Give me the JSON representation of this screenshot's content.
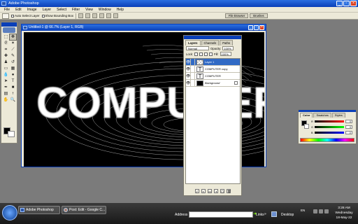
{
  "app": {
    "title": "Adobe Photoshop"
  },
  "menu": [
    "File",
    "Edit",
    "Image",
    "Layer",
    "Select",
    "Filter",
    "View",
    "Window",
    "Help"
  ],
  "options": {
    "auto_select": "Auto Select Layer",
    "bounding": "Show Bounding Box"
  },
  "well_tabs": [
    "File Browser",
    "Brushes"
  ],
  "document": {
    "title": "Untitled-1 @ 66.7% (Layer 1, RGB)",
    "canvas_text": "COMPUTER"
  },
  "layers_panel": {
    "tabs": [
      "Layers",
      "Channels",
      "Paths"
    ],
    "blend_mode": "Normal",
    "opacity_label": "Opacity:",
    "opacity": "100%",
    "lock_label": "Lock:",
    "fill_label": "Fill:",
    "fill": "100%",
    "layers": [
      {
        "name": "Layer 1",
        "eye": "👁",
        "thumb": "",
        "selected": true
      },
      {
        "name": "COMPUTER copy",
        "eye": "👁",
        "thumb": "T",
        "selected": false
      },
      {
        "name": "COMPUTER",
        "eye": "👁",
        "thumb": "T",
        "selected": false
      },
      {
        "name": "Background",
        "eye": "👁",
        "thumb": "",
        "selected": false
      }
    ]
  },
  "color_panel": {
    "tabs": [
      "Color",
      "Swatches",
      "Styles"
    ],
    "channels": [
      {
        "label": "R",
        "value": "0",
        "gradient": "linear-gradient(90deg,#000,#f00)"
      },
      {
        "label": "G",
        "value": "0",
        "gradient": "linear-gradient(90deg,#000,#0f0)"
      },
      {
        "label": "B",
        "value": "0",
        "gradient": "linear-gradient(90deg,#000,#00f)"
      }
    ]
  },
  "taskbar": {
    "buttons": [
      "Adobe Photoshop",
      "Post: Edit - Google C..."
    ],
    "address_label": "Address",
    "links": "Links",
    "desktop": "Desktop",
    "lang": "EN",
    "time": "3:28 AM",
    "day": "Wednesday",
    "date": "18-May-22"
  }
}
